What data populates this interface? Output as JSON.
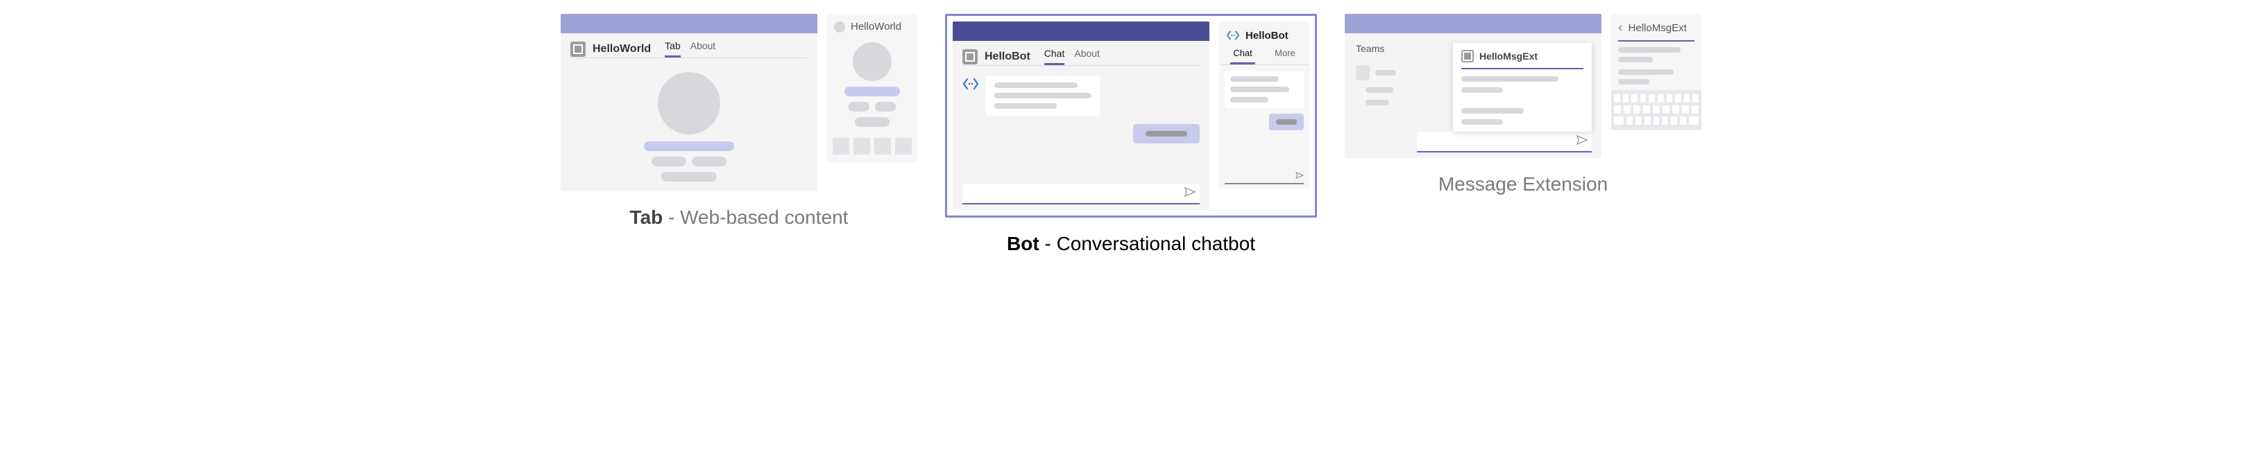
{
  "captions": {
    "tab_bold": "Tab",
    "tab_rest": " - Web-based content",
    "bot_bold": "Bot",
    "bot_rest": " - Conversational chatbot",
    "msgext": "Message Extension"
  },
  "tab": {
    "app_name": "HelloWorld",
    "tabs": [
      "Tab",
      "About"
    ],
    "active_tab": 0,
    "mobile_title": "HelloWorld"
  },
  "bot": {
    "app_name": "HelloBot",
    "tabs": [
      "Chat",
      "About"
    ],
    "active_tab": 0,
    "mobile_title": "HelloBot",
    "mobile_tabs": [
      "Chat",
      "More"
    ],
    "mobile_active_tab": 0,
    "bot_glyph": "<··>"
  },
  "msgext": {
    "sidebar_title": "Teams",
    "popup_name": "HelloMsgExt",
    "mobile_title": "HelloMsgExt"
  }
}
